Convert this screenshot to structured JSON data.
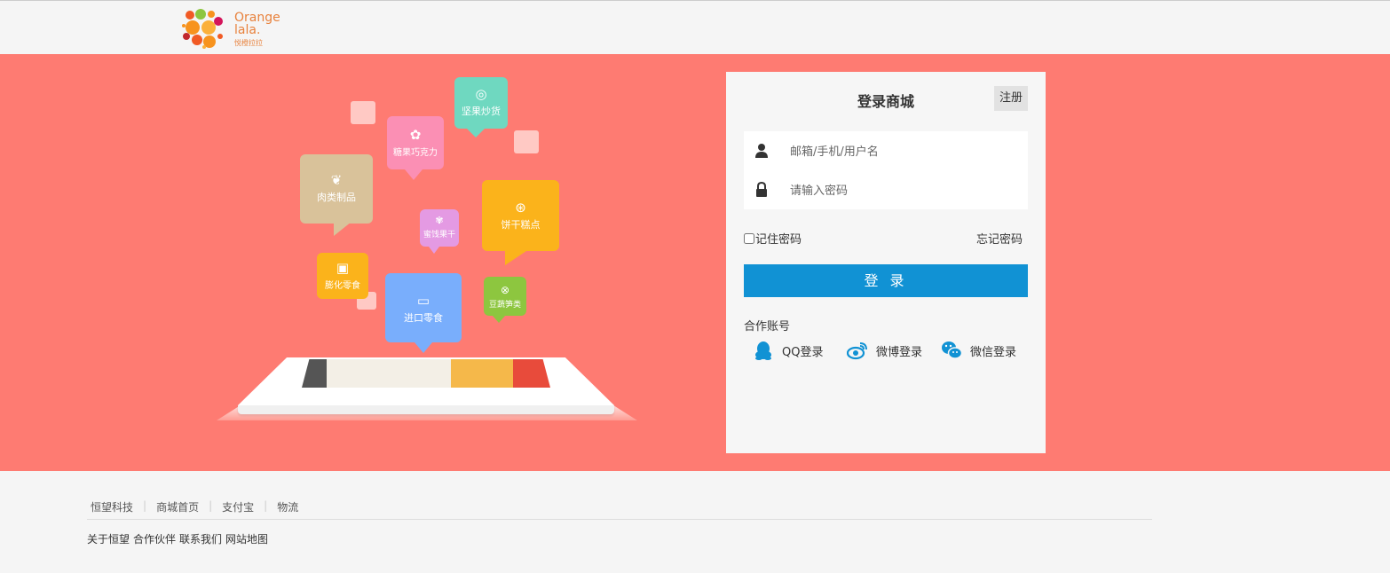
{
  "brand": {
    "logo_line1": "Orange",
    "logo_line2": "lala.",
    "logo_sub": "悦橙拉拉",
    "accent_color": "#fe7b72"
  },
  "illustration": {
    "categories": [
      {
        "label": "坚果炒货",
        "color": "#6fd8c0",
        "icon": "nut-icon"
      },
      {
        "label": "糖果巧克力",
        "color": "#fb8fb4",
        "icon": "candy-icon"
      },
      {
        "label": "肉类制品",
        "color": "#d9c29a",
        "icon": "meat-icon"
      },
      {
        "label": "蜜饯果干",
        "color": "#e49ae3",
        "icon": "dried-fruit-icon"
      },
      {
        "label": "饼干糕点",
        "color": "#fbb31b",
        "icon": "cookie-icon"
      },
      {
        "label": "膨化零食",
        "color": "#fbb31b",
        "icon": "puffed-snack-icon"
      },
      {
        "label": "进口零食",
        "color": "#79aefc",
        "icon": "imported-snack-icon"
      },
      {
        "label": "豆蔬笋类",
        "color": "#8dc63f",
        "icon": "bean-icon"
      }
    ]
  },
  "login": {
    "title": "登录商城",
    "register_label": "注册",
    "username_placeholder": "邮箱/手机/用户名",
    "password_placeholder": "请输入密码",
    "remember_label": "记住密码",
    "forgot_label": "忘记密码",
    "submit_label": "登 录",
    "partner_label": "合作账号",
    "social": [
      {
        "label": "QQ登录",
        "icon": "qq-icon"
      },
      {
        "label": "微博登录",
        "icon": "weibo-icon"
      },
      {
        "label": "微信登录",
        "icon": "wechat-icon"
      }
    ],
    "primary_color": "#1192d4"
  },
  "footer": {
    "links": [
      "恒望科技",
      "商城首页",
      "支付宝",
      "物流"
    ],
    "bottom_links": [
      "关于恒望",
      "合作伙伴",
      "联系我们",
      "网站地图"
    ]
  }
}
